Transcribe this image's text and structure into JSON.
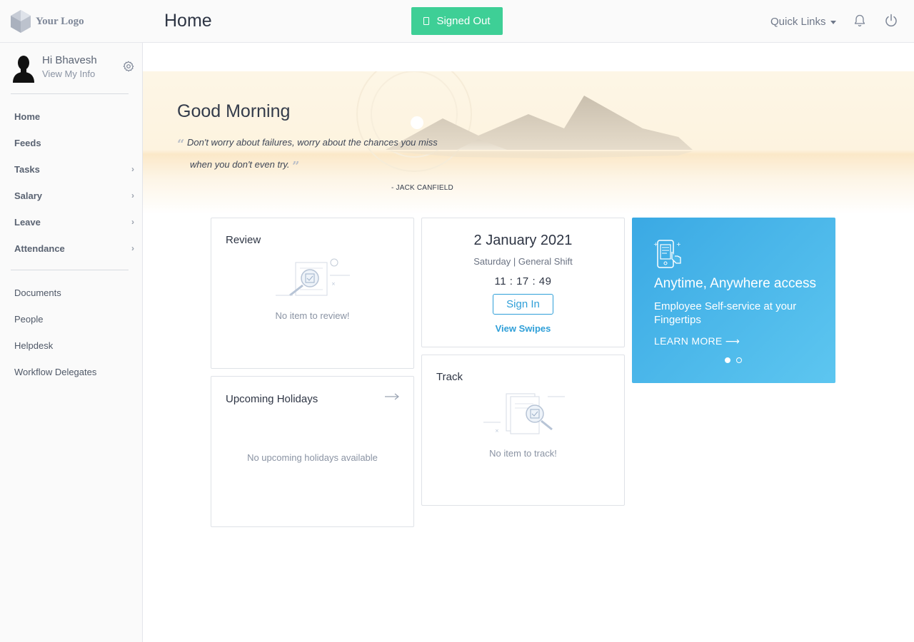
{
  "header": {
    "logo_text": "Your Logo",
    "page_title": "Home",
    "status_button": "Signed Out",
    "quick_links": "Quick Links"
  },
  "sidebar": {
    "greeting": "Hi Bhavesh",
    "view_info": "View My Info",
    "primary_items": [
      {
        "label": "Home",
        "has_submenu": false
      },
      {
        "label": "Feeds",
        "has_submenu": false
      },
      {
        "label": "Tasks",
        "has_submenu": true
      },
      {
        "label": "Salary",
        "has_submenu": true
      },
      {
        "label": "Leave",
        "has_submenu": true
      },
      {
        "label": "Attendance",
        "has_submenu": true
      }
    ],
    "secondary_items": [
      {
        "label": "Documents"
      },
      {
        "label": "People"
      },
      {
        "label": "Helpdesk"
      },
      {
        "label": "Workflow Delegates"
      }
    ]
  },
  "hero": {
    "greeting": "Good Morning",
    "quote_line1": "Don't worry about failures, worry about the chances you miss",
    "quote_line2": "when you don't even try.",
    "author": "- JACK CANFIELD"
  },
  "review": {
    "title": "Review",
    "empty": "No item to review!"
  },
  "attendance": {
    "date": "2 January 2021",
    "shift": "Saturday | General Shift",
    "time": "11 : 17 : 49",
    "sign_in": "Sign In",
    "view_swipes": "View Swipes"
  },
  "promo": {
    "title": "Anytime, Anywhere access",
    "subtitle": "Employee Self-service at your Fingertips",
    "link": "LEARN MORE ⟶",
    "active_slide": 1,
    "slide_count": 2
  },
  "holidays": {
    "title": "Upcoming Holidays",
    "empty": "No upcoming holidays available"
  },
  "track": {
    "title": "Track",
    "empty": "No item to track!"
  },
  "colors": {
    "accent_green": "#3ecf96",
    "accent_blue": "#2f9fd8",
    "promo_gradient_start": "#3aa9e4",
    "promo_gradient_end": "#5dc6f0"
  }
}
